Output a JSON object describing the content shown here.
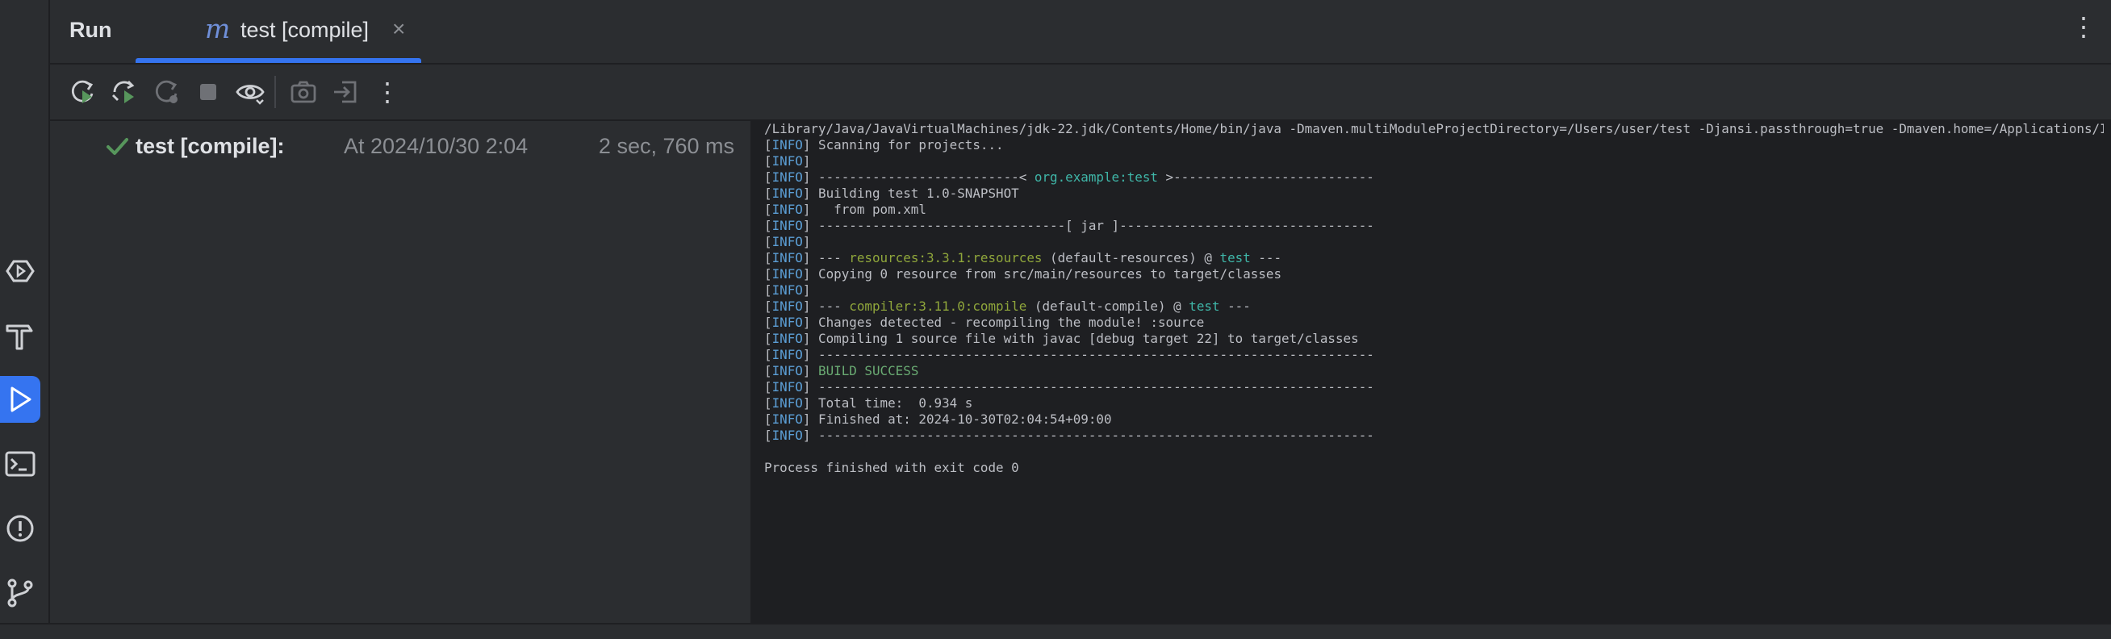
{
  "header": {
    "run_title": "Run",
    "tab_icon": "m",
    "tab_label": "test [compile]",
    "tab_close": "×",
    "more": "⋮"
  },
  "colors": {
    "accent": "#3574f0",
    "success": "#6aab73",
    "info_tag": "#5c9fd6",
    "artifact_teal": "#3fb6a8",
    "plugin_green": "#8fa63b"
  },
  "left_strip_icons": [
    "services-icon",
    "build-hammer-icon",
    "run-icon",
    "terminal-icon",
    "problems-icon",
    "git-branch-icon"
  ],
  "toolbar": {
    "buttons": [
      "rerun-icon",
      "rerun-failed-icon",
      "rerun-automatically-icon",
      "stop-icon",
      "show-icon",
      "screenshot-icon",
      "export-icon",
      "more-icon"
    ],
    "more_label": "⋮"
  },
  "tree": {
    "name": "test [compile]:",
    "when": "At 2024/10/30 2:04",
    "duration": "2 sec, 760 ms"
  },
  "console": {
    "lines": [
      {
        "tag": "",
        "parts": [
          {
            "t": "/Library/Java/JavaVirtualMachines/jdk-22.jdk/Contents/Home/bin/java -Dmaven.multiModuleProjectDirectory=/Users/user/test -Djansi.passthrough=true -Dmaven.home=/Applications/I",
            "c": ""
          }
        ]
      },
      {
        "tag": "INFO",
        "parts": [
          {
            "t": " Scanning for projects...",
            "c": ""
          }
        ]
      },
      {
        "tag": "INFO",
        "parts": []
      },
      {
        "tag": "INFO",
        "parts": [
          {
            "t": " --------------------------< ",
            "c": ""
          },
          {
            "t": "org.example:test",
            "c": "teal"
          },
          {
            "t": " >--------------------------",
            "c": ""
          }
        ]
      },
      {
        "tag": "INFO",
        "parts": [
          {
            "t": " Building test 1.0-SNAPSHOT",
            "c": ""
          }
        ]
      },
      {
        "tag": "INFO",
        "parts": [
          {
            "t": "   from pom.xml",
            "c": ""
          }
        ]
      },
      {
        "tag": "INFO",
        "parts": [
          {
            "t": " --------------------------------[ jar ]---------------------------------",
            "c": ""
          }
        ]
      },
      {
        "tag": "INFO",
        "parts": []
      },
      {
        "tag": "INFO",
        "parts": [
          {
            "t": " --- ",
            "c": ""
          },
          {
            "t": "resources:3.3.1:resources",
            "c": "green"
          },
          {
            "t": " (default-resources) @ ",
            "c": ""
          },
          {
            "t": "test",
            "c": "teal"
          },
          {
            "t": " ---",
            "c": ""
          }
        ]
      },
      {
        "tag": "INFO",
        "parts": [
          {
            "t": " Copying 0 resource from src/main/resources to target/classes",
            "c": ""
          }
        ]
      },
      {
        "tag": "INFO",
        "parts": []
      },
      {
        "tag": "INFO",
        "parts": [
          {
            "t": " --- ",
            "c": ""
          },
          {
            "t": "compiler:3.11.0:compile",
            "c": "green"
          },
          {
            "t": " (default-compile) @ ",
            "c": ""
          },
          {
            "t": "test",
            "c": "teal"
          },
          {
            "t": " ---",
            "c": ""
          }
        ]
      },
      {
        "tag": "INFO",
        "parts": [
          {
            "t": " Changes detected - recompiling the module! :source",
            "c": ""
          }
        ]
      },
      {
        "tag": "INFO",
        "parts": [
          {
            "t": " Compiling 1 source file with javac [debug target 22] to target/classes",
            "c": ""
          }
        ]
      },
      {
        "tag": "INFO",
        "parts": [
          {
            "t": " ------------------------------------------------------------------------",
            "c": ""
          }
        ]
      },
      {
        "tag": "INFO",
        "parts": [
          {
            "t": " ",
            "c": ""
          },
          {
            "t": "BUILD SUCCESS",
            "c": "success"
          }
        ]
      },
      {
        "tag": "INFO",
        "parts": [
          {
            "t": " ------------------------------------------------------------------------",
            "c": ""
          }
        ]
      },
      {
        "tag": "INFO",
        "parts": [
          {
            "t": " Total time:  0.934 s",
            "c": ""
          }
        ]
      },
      {
        "tag": "INFO",
        "parts": [
          {
            "t": " Finished at: 2024-10-30T02:04:54+09:00",
            "c": ""
          }
        ]
      },
      {
        "tag": "INFO",
        "parts": [
          {
            "t": " ------------------------------------------------------------------------",
            "c": ""
          }
        ]
      },
      {
        "tag": "",
        "parts": []
      },
      {
        "tag": "",
        "parts": [
          {
            "t": "Process finished with exit code 0",
            "c": ""
          }
        ]
      }
    ]
  }
}
